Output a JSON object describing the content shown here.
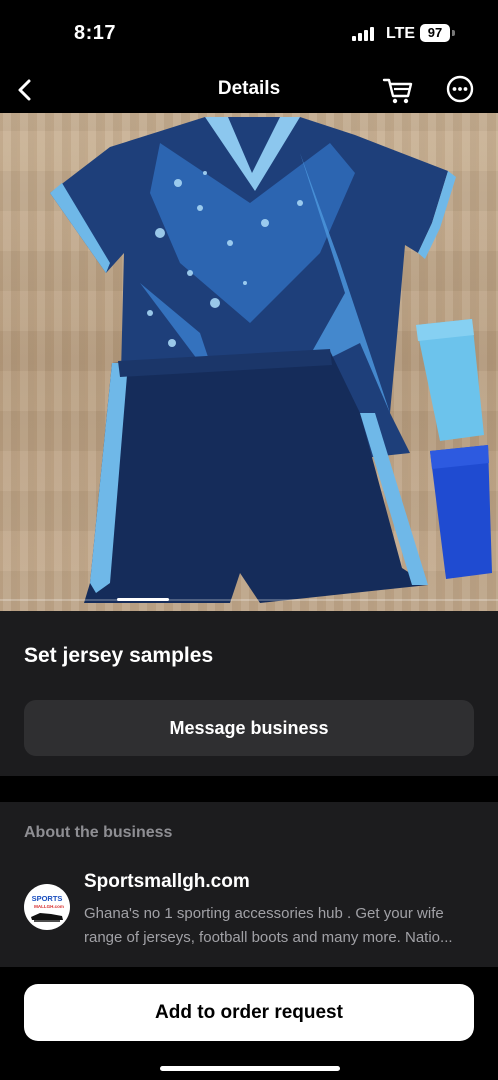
{
  "status_bar": {
    "time": "8:17",
    "network": "LTE",
    "battery": "97"
  },
  "nav": {
    "title": "Details",
    "icons": [
      "back-arrow-icon",
      "cart-icon",
      "more-options-icon"
    ]
  },
  "product": {
    "image_description": "",
    "carousel": {
      "current": 1
    },
    "title": "Set jersey samples",
    "message_button": "Message business"
  },
  "about": {
    "heading": "About the business",
    "logo_text": "SPORTS",
    "logo_subtext": "MALLGH.com",
    "business_name": "Sportsmallgh.com",
    "description_line1": "Ghana's no 1 sporting accessories hub . Get your wife",
    "description_line2": "range of jerseys, football boots and many more. Natio..."
  },
  "bottom": {
    "order_button": "Add to order request"
  },
  "colors": {
    "background": "#000000",
    "card": "#1c1c1e",
    "button_dark": "#2f2f31",
    "button_light": "#ffffff",
    "muted_text": "#8e8e93",
    "jersey_navy": "#1e3f7a",
    "jersey_sky": "#6fb8e8"
  }
}
